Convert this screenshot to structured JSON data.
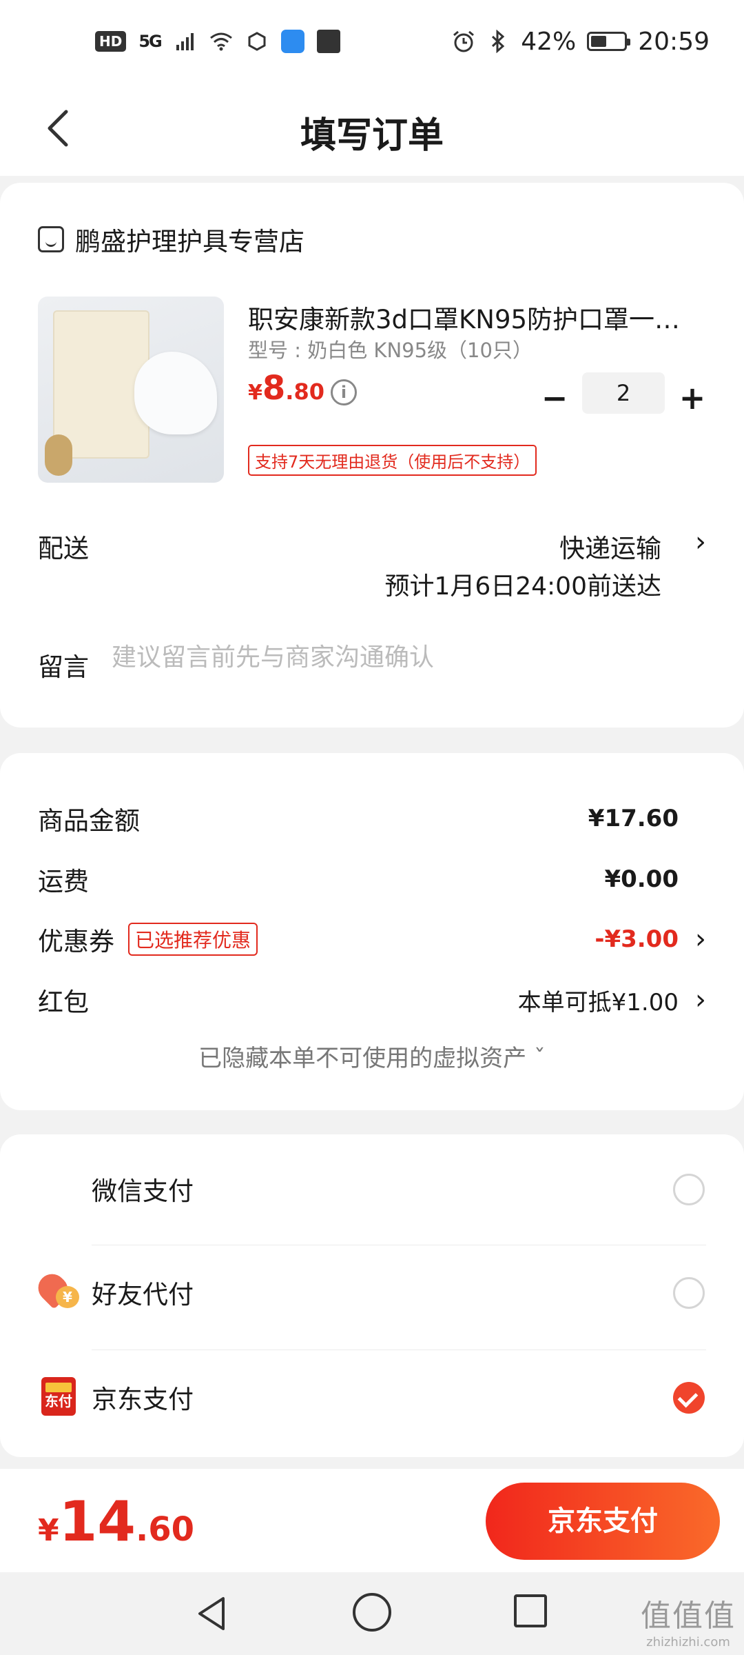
{
  "status_bar": {
    "hd": "HD",
    "network": "5G",
    "battery": "42%",
    "time": "20:59"
  },
  "nav": {
    "title": "填写订单"
  },
  "store": {
    "name": "鹏盛护理护具专营店"
  },
  "product": {
    "name": "职安康新款3d口罩KN95防护口罩一…",
    "spec": "型号 : 奶白色 KN95级（10只）",
    "price_currency": "¥",
    "price_int": "8",
    "price_dec": ".80",
    "quantity": "2",
    "return_tag": "支持7天无理由退货（使用后不支持）"
  },
  "delivery": {
    "label": "配送",
    "method": "快递运输",
    "eta": "预计1月6日24:00前送达"
  },
  "message": {
    "label": "留言",
    "placeholder": "建议留言前先与商家沟通确认"
  },
  "fees": {
    "goods_label": "商品金额",
    "goods_value": "¥17.60",
    "shipping_label": "运费",
    "shipping_value": "¥0.00",
    "coupon_label": "优惠券",
    "coupon_badge": "已选推荐优惠",
    "coupon_value": "-¥3.00",
    "redpacket_label": "红包",
    "redpacket_value": "本单可抵¥1.00",
    "hidden_assets": "已隐藏本单不可使用的虚拟资产 ˇ"
  },
  "payment_methods": [
    {
      "label": "微信支付",
      "selected": false
    },
    {
      "label": "好友代付",
      "selected": false
    },
    {
      "label": "京东支付",
      "selected": true
    }
  ],
  "payment_icons": {
    "friend_badge": "¥",
    "jd_badge": "东付"
  },
  "bottom": {
    "total_currency": "¥",
    "total_int": "14",
    "total_dec": ".60",
    "pay_button": "京东支付"
  },
  "watermark": {
    "big": "值值值",
    "small": "zhizhizhi.com"
  },
  "colors": {
    "accent": "#e22a1e",
    "wechat": "#1aad19",
    "button_gradient_start": "#f1271c",
    "button_gradient_end": "#fa6a2a"
  }
}
